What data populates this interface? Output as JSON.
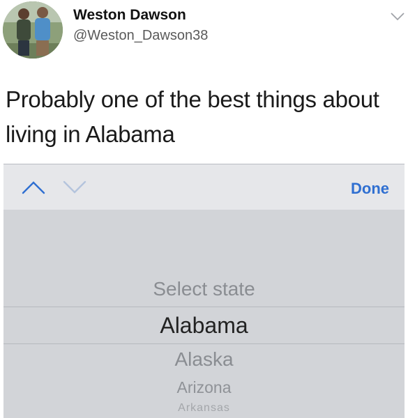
{
  "tweet": {
    "author_name": "Weston Dawson",
    "author_handle": "@Weston_Dawson38",
    "text": "Probably one of the best things about living in Alabama",
    "menu_icon": "chevron-down-icon"
  },
  "picker": {
    "toolbar": {
      "prev_icon": "chevron-up-icon",
      "next_icon": "chevron-down-icon",
      "done_label": "Done",
      "accent_color": "#2f6fd1"
    },
    "options": {
      "placeholder": "Select state",
      "selected": "Alabama",
      "next": "Alaska",
      "next2": "Arizona",
      "next3": "Arkansas"
    },
    "background_color": "#d2d4d8"
  }
}
